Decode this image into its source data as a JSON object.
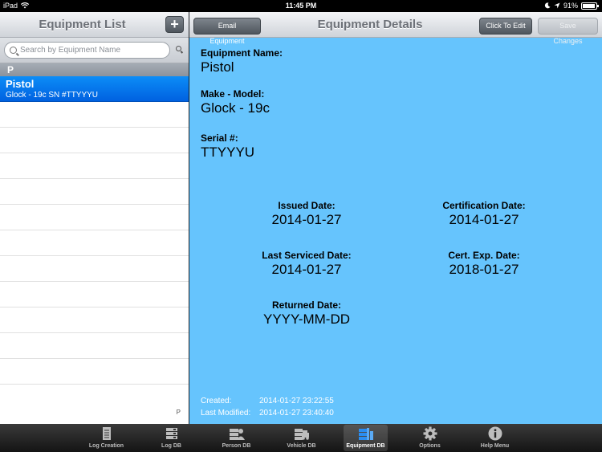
{
  "status": {
    "device": "iPad",
    "time": "11:45 PM",
    "battery": "91%",
    "battery_level": 0.91
  },
  "left": {
    "title": "Equipment List",
    "add_label": "+",
    "search_placeholder": "Search by Equipment Name",
    "section": "P",
    "items": [
      {
        "title": "Pistol",
        "subtitle": "Glock - 19c SN #TTYYYU"
      }
    ],
    "index_letter": "P"
  },
  "right": {
    "title": "Equipment Details",
    "email_label": "Email Equipment",
    "edit_label": "Click To Edit",
    "save_label": "Save Changes",
    "name_label": "Equipment Name:",
    "name_value": "Pistol",
    "make_label": "Make - Model:",
    "make_value": "Glock - 19c",
    "serial_label": "Serial #:",
    "serial_value": "TTYYYU",
    "issued_label": "Issued Date:",
    "issued_value": "2014-01-27",
    "cert_label": "Certification Date:",
    "cert_value": "2014-01-27",
    "serviced_label": "Last Serviced Date:",
    "serviced_value": "2014-01-27",
    "certexp_label": "Cert. Exp. Date:",
    "certexp_value": "2018-01-27",
    "returned_label": "Returned Date:",
    "returned_value": "YYYY-MM-DD",
    "created_label": "Created:",
    "created_value": "2014-01-27 23:22:55",
    "modified_label": "Last Modified:",
    "modified_value": "2014-01-27 23:40:40"
  },
  "tabs": [
    {
      "label": "Log Creation",
      "icon": "notepad-icon"
    },
    {
      "label": "Log DB",
      "icon": "database-icon"
    },
    {
      "label": "Person DB",
      "icon": "person-database-icon"
    },
    {
      "label": "Vehicle DB",
      "icon": "vehicle-database-icon"
    },
    {
      "label": "Equipment DB",
      "icon": "equipment-database-icon",
      "active": true
    },
    {
      "label": "Options",
      "icon": "gear-icon"
    },
    {
      "label": "Help Menu",
      "icon": "info-icon"
    }
  ]
}
